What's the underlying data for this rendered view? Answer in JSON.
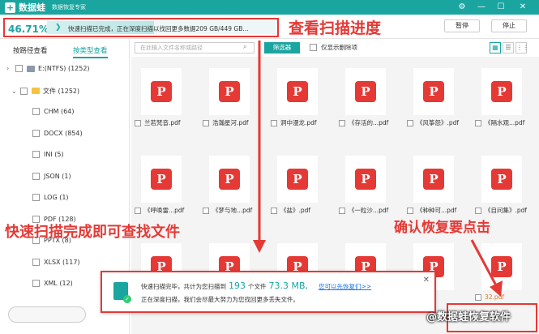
{
  "titlebar": {
    "app_name": "数据蛙",
    "subtitle": "数据恢复专家",
    "logo_glyph": "+",
    "controls": [
      "⚙",
      "—",
      "☐",
      "✕"
    ]
  },
  "progress": {
    "percent_text": "46.71%",
    "percent_value": 46.71,
    "status_text": "快速扫描已完成，正在深度扫描以找回更多数据209 GB/449 GB...",
    "pause_label": "暂停",
    "stop_label": "停止"
  },
  "annotations": {
    "progress": "查看扫描进度",
    "quick_scan": "快速扫描完成即可查找文件",
    "recover": "确认恢复要点击"
  },
  "leftpanel": {
    "tab_path": "按路径查看",
    "tab_type": "按类型查看",
    "tree": [
      {
        "label": "E:(NTFS) (1252)",
        "kind": "drive",
        "level": 0
      },
      {
        "label": "文件 (1252)",
        "kind": "folder",
        "level": 1
      },
      {
        "label": "CHM (64)",
        "kind": "type",
        "level": 2
      },
      {
        "label": "DOCX (854)",
        "kind": "type",
        "level": 2
      },
      {
        "label": "INI (5)",
        "kind": "type",
        "level": 2
      },
      {
        "label": "JSON (1)",
        "kind": "type",
        "level": 2
      },
      {
        "label": "LOG (1)",
        "kind": "type",
        "level": 2
      },
      {
        "label": "PDF (128)",
        "kind": "type",
        "level": 2
      },
      {
        "label": "PPTX (8)",
        "kind": "type",
        "level": 2
      },
      {
        "label": "XLSX (117)",
        "kind": "type",
        "level": 2
      },
      {
        "label": "XML (12)",
        "kind": "type",
        "level": 2
      }
    ]
  },
  "toolbar": {
    "search_placeholder": "在此输入文件名称或路径",
    "filter_label": "筛选器",
    "deleted_only_label": "仅显示删除项",
    "view_icons": [
      "▦",
      "☰",
      "⋮⋮"
    ]
  },
  "files": [
    {
      "name": "兰若梵音.pdf"
    },
    {
      "name": "浩瀚星河.pdf"
    },
    {
      "name": "洞中漫龙.pdf"
    },
    {
      "name": "《存活的...pdf"
    },
    {
      "name": "《风筝怨》.pdf"
    },
    {
      "name": "《隔水观...pdf"
    },
    {
      "name": "《呼唤雷...pdf"
    },
    {
      "name": "《梦与地...pdf"
    },
    {
      "name": "《盐》.pdf"
    },
    {
      "name": "《一粒沙...pdf"
    },
    {
      "name": "《种种可...pdf"
    },
    {
      "name": "《自问集》.pdf"
    },
    {
      "name": ""
    },
    {
      "name": ""
    },
    {
      "name": ""
    },
    {
      "name": ""
    },
    {
      "name": ".pdf"
    },
    {
      "name": "32.pdf"
    }
  ],
  "file_icon": "P",
  "popup": {
    "line1_prefix": "快速扫描完毕，共计为您扫描到",
    "count": "193",
    "count_suffix": "个文件",
    "size": "73.3 MB,",
    "link": "您可以先恢复们>>",
    "line2": "正在深度扫描，我们会尽最大努力为您找回更多丢失文件。",
    "close": "✕"
  },
  "watermark": "@数据蛙恢复软件"
}
